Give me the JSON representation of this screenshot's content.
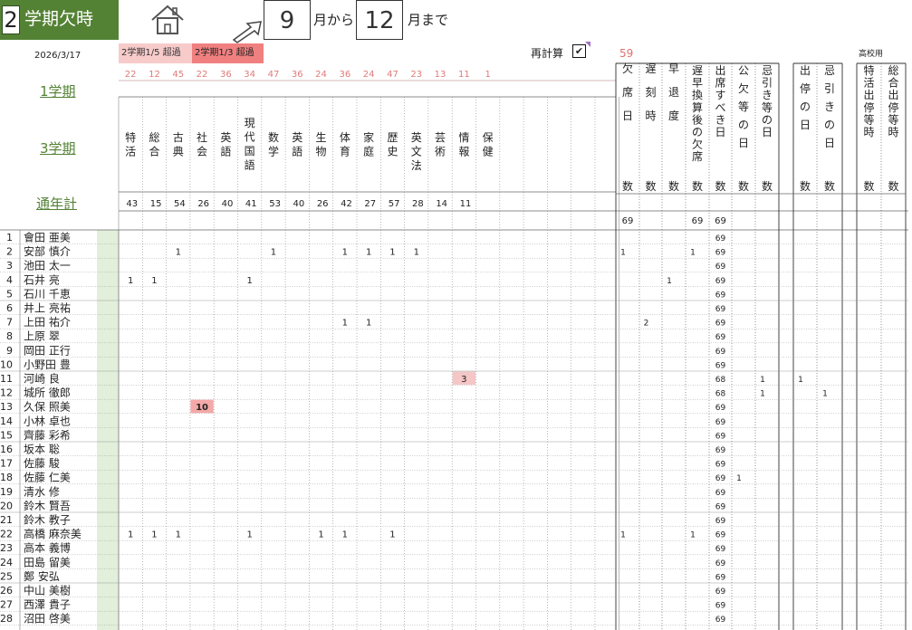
{
  "header": {
    "term_number": "2",
    "term_label": "学期欠時",
    "month_from": "9",
    "month_from_suffix": "月から",
    "month_to": "12",
    "month_to_suffix": "月まで",
    "date": "2026/3/17",
    "badge_1_5": "2学期1/5 超過",
    "badge_1_3": "2学期1/3 超過",
    "recalc_label": "再計算",
    "recalc_checked": "✔",
    "total_days": "59",
    "school_type": "高校用"
  },
  "side_links": {
    "term1": "1学期",
    "term3": "3学期",
    "year_total": "通年計"
  },
  "subjects": [
    {
      "name": "特活",
      "top": "22",
      "bottom": "43"
    },
    {
      "name": "総合",
      "top": "12",
      "bottom": "15"
    },
    {
      "name": "古典",
      "top": "45",
      "bottom": "54"
    },
    {
      "name": "社会",
      "top": "22",
      "bottom": "26"
    },
    {
      "name": "英語",
      "top": "36",
      "bottom": "40"
    },
    {
      "name": "現代国語",
      "top": "34",
      "bottom": "41"
    },
    {
      "name": "数学",
      "top": "47",
      "bottom": "53"
    },
    {
      "name": "英語",
      "top": "36",
      "bottom": "40"
    },
    {
      "name": "生物",
      "top": "24",
      "bottom": "26"
    },
    {
      "name": "体育",
      "top": "36",
      "bottom": "42"
    },
    {
      "name": "家庭",
      "top": "24",
      "bottom": "27"
    },
    {
      "name": "歴史",
      "top": "47",
      "bottom": "57"
    },
    {
      "name": "英文法",
      "top": "23",
      "bottom": "28"
    },
    {
      "name": "芸術",
      "top": "13",
      "bottom": "14"
    },
    {
      "name": "情報",
      "top": "11",
      "bottom": "11"
    },
    {
      "name": "保健",
      "top": "1",
      "bottom": ""
    },
    {
      "name": "",
      "top": "",
      "bottom": ""
    },
    {
      "name": "",
      "top": "",
      "bottom": ""
    },
    {
      "name": "",
      "top": "",
      "bottom": ""
    },
    {
      "name": "",
      "top": "",
      "bottom": ""
    },
    {
      "name": "",
      "top": "",
      "bottom": ""
    }
  ],
  "summary_cols": [
    {
      "name": "欠席日数",
      "bottom": "69"
    },
    {
      "name": "遅刻時数",
      "bottom": ""
    },
    {
      "name": "早退度数",
      "bottom": ""
    },
    {
      "name": "遅早換算後の欠席数",
      "bottom": "69"
    },
    {
      "name": "出席すべき日数",
      "bottom": "69"
    },
    {
      "name": "公欠等の日数",
      "bottom": ""
    },
    {
      "name": "忌引き等の日数",
      "bottom": ""
    },
    {
      "name": "出停の日数",
      "bottom": ""
    },
    {
      "name": "忌引きの日数",
      "bottom": ""
    },
    {
      "name": "特活出停等時数",
      "bottom": ""
    },
    {
      "name": "総合出停等時数",
      "bottom": ""
    }
  ],
  "students": [
    {
      "no": "1",
      "name": "會田 亜美",
      "s": {},
      "m": {
        "4": "69"
      }
    },
    {
      "no": "2",
      "name": "安部 慎介",
      "s": {
        "2": "1",
        "6": "1",
        "9": "1",
        "10": "1",
        "11": "1",
        "12": "1"
      },
      "m": {
        "0": "1",
        "3": "1",
        "4": "69"
      }
    },
    {
      "no": "3",
      "name": "池田 太一",
      "s": {},
      "m": {
        "4": "69"
      }
    },
    {
      "no": "4",
      "name": "石井 亮",
      "s": {
        "0": "1",
        "1": "1",
        "5": "1"
      },
      "m": {
        "2": "1",
        "4": "69"
      }
    },
    {
      "no": "5",
      "name": "石川 千恵",
      "s": {},
      "m": {
        "4": "69"
      }
    },
    {
      "no": "6",
      "name": "井上 亮祐",
      "s": {},
      "m": {
        "4": "69"
      }
    },
    {
      "no": "7",
      "name": "上田 祐介",
      "s": {
        "9": "1",
        "10": "1"
      },
      "m": {
        "1": "2",
        "4": "69"
      }
    },
    {
      "no": "8",
      "name": "上原 翠",
      "s": {},
      "m": {
        "4": "69"
      }
    },
    {
      "no": "9",
      "name": "岡田 正行",
      "s": {},
      "m": {
        "4": "69"
      }
    },
    {
      "no": "10",
      "name": "小野田 豊",
      "s": {},
      "m": {
        "4": "69"
      }
    },
    {
      "no": "11",
      "name": "河崎 良",
      "s": {
        "14": "3"
      },
      "m": {
        "4": "68",
        "6": "1",
        "7": "1"
      }
    },
    {
      "no": "12",
      "name": "城所 徹郎",
      "s": {},
      "m": {
        "4": "68",
        "6": "1",
        "8": "1"
      }
    },
    {
      "no": "13",
      "name": "久保 照美",
      "s": {
        "3": "10"
      },
      "m": {
        "4": "69"
      }
    },
    {
      "no": "14",
      "name": "小林 卓也",
      "s": {},
      "m": {
        "4": "69"
      }
    },
    {
      "no": "15",
      "name": "齊藤 彩希",
      "s": {},
      "m": {
        "4": "69"
      }
    },
    {
      "no": "16",
      "name": "坂本 聡",
      "s": {},
      "m": {
        "4": "69"
      }
    },
    {
      "no": "17",
      "name": "佐藤 駿",
      "s": {},
      "m": {
        "4": "69"
      }
    },
    {
      "no": "18",
      "name": "佐藤 仁美",
      "s": {},
      "m": {
        "4": "69",
        "5": "1"
      }
    },
    {
      "no": "19",
      "name": "清水 修",
      "s": {},
      "m": {
        "4": "69"
      }
    },
    {
      "no": "20",
      "name": "鈴木 賢吾",
      "s": {},
      "m": {
        "4": "69"
      }
    },
    {
      "no": "21",
      "name": "鈴木 教子",
      "s": {},
      "m": {
        "4": "69"
      }
    },
    {
      "no": "22",
      "name": "高橋 麻奈美",
      "s": {
        "0": "1",
        "1": "1",
        "2": "1",
        "5": "1",
        "8": "1",
        "9": "1",
        "11": "1"
      },
      "m": {
        "0": "1",
        "3": "1",
        "4": "69"
      }
    },
    {
      "no": "23",
      "name": "高本 義博",
      "s": {},
      "m": {
        "4": "69"
      }
    },
    {
      "no": "24",
      "name": "田島 留美",
      "s": {},
      "m": {
        "4": "69"
      }
    },
    {
      "no": "25",
      "name": "鄭 安弘",
      "s": {},
      "m": {
        "4": "69"
      }
    },
    {
      "no": "26",
      "name": "中山 美樹",
      "s": {},
      "m": {
        "4": "69"
      }
    },
    {
      "no": "27",
      "name": "西澤 貴子",
      "s": {},
      "m": {
        "4": "69"
      }
    },
    {
      "no": "28",
      "name": "沼田 啓美",
      "s": {},
      "m": {
        "4": "69"
      }
    }
  ],
  "highlights": {
    "cell_pink": "#f4c6c6",
    "cell_red": "#f4a8a8",
    "accent_green": "#548235",
    "side_green": "#e2efda"
  }
}
